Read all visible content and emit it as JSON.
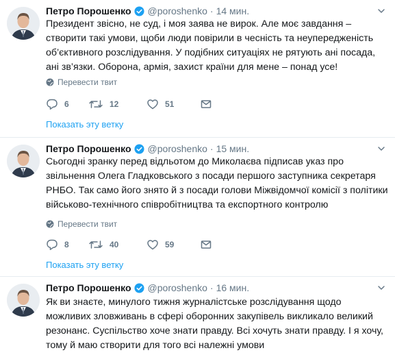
{
  "author": {
    "name": "Петро Порошенко",
    "handle": "@poroshenko"
  },
  "tweets": [
    {
      "time": "14 мин.",
      "text": "Президент звісно, не суд, і моя заява не вирок. Але моє завдання – створити такі умови, щоби люди повірили в чесність та неупередженість об’єктивного розслідування. У подібних ситуаціях не рятують ані посада, ані зв’язки. Оборона, армія, захист країни для мене – понад усе!",
      "translate_label": "Перевести твит",
      "replies": "6",
      "retweets": "12",
      "likes": "51",
      "show_thread_label": "Показать эту ветку"
    },
    {
      "time": "15 мин.",
      "text": "Сьогодні зранку перед відльотом до Миколаєва підписав указ про звільнення Олега Гладковського з посади першого заступника секретаря РНБО. Так само його знято й з посади голови Міжвідомчої комісії з політики військово-технічного співробітництва та експортного контролю",
      "translate_label": "Перевести твит",
      "replies": "8",
      "retweets": "40",
      "likes": "59",
      "show_thread_label": "Показать эту ветку"
    },
    {
      "time": "16 мин.",
      "text": "Як ви знаєте, минулого тижня журналістське розслідування щодо можливих зловживань в сфері оборонних закупівель викликало великий резонанс. Суспільство хоче знати правду. Всі хочуть знати правду. І я хочу, тому й маю створити для того всі належні умови"
    }
  ],
  "colors": {
    "link": "#1da1f2",
    "secondary": "#657786",
    "verified": "#1da1f2",
    "text": "#14171a"
  },
  "icons": [
    "avatar",
    "verified-badge-icon",
    "chevron-down-icon",
    "globe-icon",
    "reply-icon",
    "retweet-icon",
    "like-icon",
    "direct-message-icon"
  ]
}
